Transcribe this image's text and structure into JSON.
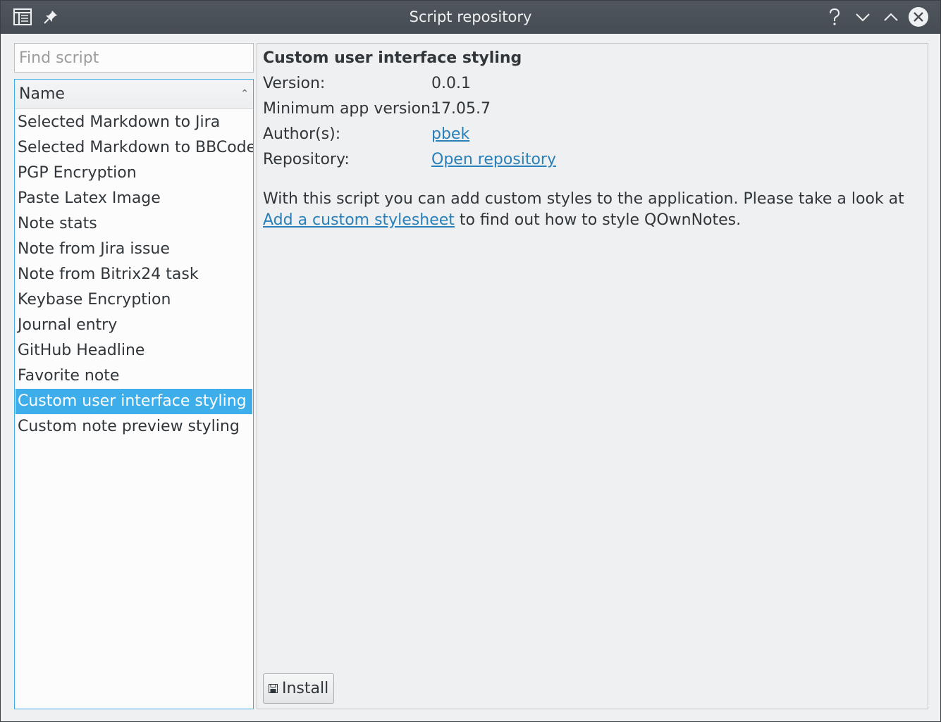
{
  "window": {
    "title": "Script repository"
  },
  "search": {
    "placeholder": "Find script",
    "value": ""
  },
  "list": {
    "header": "Name",
    "items": [
      "Selected Markdown to Jira",
      "Selected Markdown to BBCode",
      "PGP Encryption",
      "Paste Latex Image",
      "Note stats",
      "Note from Jira issue",
      "Note from Bitrix24 task",
      "Keybase Encryption",
      "Journal entry",
      "GitHub Headline",
      "Favorite note",
      "Custom user interface styling",
      "Custom note preview styling"
    ],
    "selected_index": 11
  },
  "details": {
    "title": "Custom user interface styling",
    "version_label": "Version:",
    "version_value": "0.0.1",
    "min_version_label": "Minimum app version:",
    "min_version_value": "17.05.7",
    "authors_label": "Author(s):",
    "authors_value": "pbek",
    "repository_label": "Repository:",
    "repository_value": "Open repository",
    "description_before": "With this script you can add custom styles to the application. Please take a look at ",
    "description_link": "Add a custom stylesheet",
    "description_after": " to find out how to style QOwnNotes.",
    "install_label": "Install"
  },
  "icons": {
    "menu": "window-menu-icon",
    "pin": "pin-icon",
    "help": "help-icon",
    "minimize": "minimize-icon",
    "maximize": "maximize-icon",
    "close": "close-icon",
    "install": "save-icon"
  },
  "colors": {
    "accent": "#3daee9",
    "link": "#2980b9",
    "titlebar": "#4b5157"
  }
}
